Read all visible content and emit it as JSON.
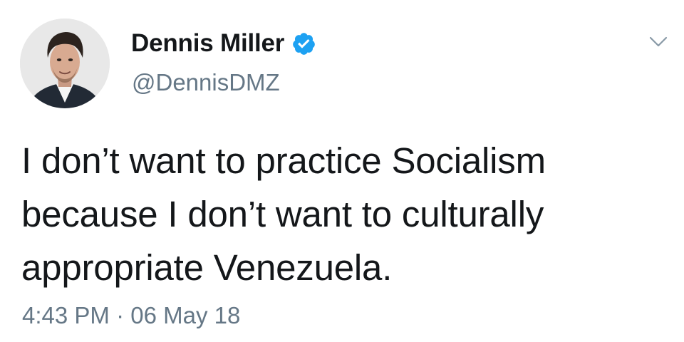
{
  "tweet": {
    "author": {
      "display_name": "Dennis Miller",
      "handle": "@DennisDMZ",
      "verified": true,
      "avatar_icon": "profile-photo",
      "verified_icon": "verified-badge-icon"
    },
    "text": "I don’t want to practice Socialism\nbecause I don’t want to culturally\nappropriate Venezuela.",
    "timestamp": "4:43 PM · 06 May 18",
    "menu_icon": "chevron-down-icon"
  },
  "colors": {
    "primary_text": "#14171a",
    "secondary_text": "#657786",
    "verified_blue": "#1da1f2",
    "background": "#ffffff"
  }
}
